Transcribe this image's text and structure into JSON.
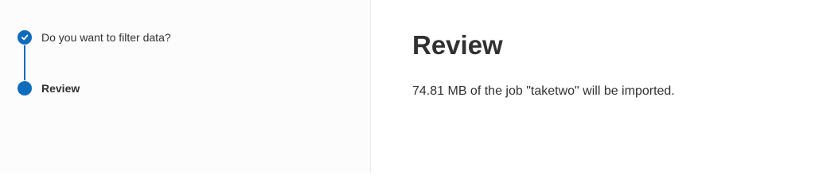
{
  "wizard": {
    "steps": [
      {
        "label": "Do you want to filter data?",
        "status": "completed",
        "icon": "checkmark-icon"
      },
      {
        "label": "Review",
        "status": "current",
        "icon": "current-step-icon"
      }
    ]
  },
  "review": {
    "title": "Review",
    "message": "74.81 MB of the job \"taketwo\" will be imported."
  },
  "colors": {
    "accent": "#0f6cbd",
    "text": "#323130",
    "divider": "#edebe9"
  }
}
